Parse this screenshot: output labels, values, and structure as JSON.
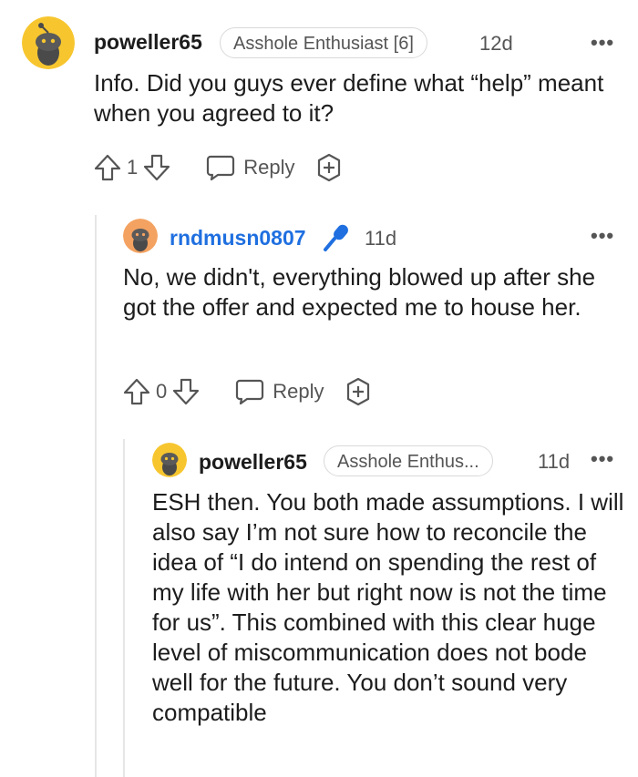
{
  "comments": [
    {
      "username": "poweller65",
      "flair": "Asshole Enthusiast [6]",
      "time": "12d",
      "body": "Info. Did you guys ever define what “help” meant when you agreed to it?",
      "vote_count": "1",
      "reply_label": "Reply",
      "avatar_color": "#f7c62f"
    },
    {
      "username": "rndmusn0807",
      "time": "11d",
      "body": "No, we didn't, everything blowed up after she got the offer and expected me to house her.",
      "vote_count": "0",
      "reply_label": "Reply",
      "avatar_color": "#f4a261",
      "username_color": "#1f6fe0"
    },
    {
      "username": "poweller65",
      "flair": "Asshole Enthus...",
      "time": "11d",
      "body": "ESH then. You both made assumptions. I will also say I’m not sure how to reconcile the idea of “I do intend on spending the rest of my life with her but right now is not the time for us”. This combined with this clear huge level of miscommunication does not bode well for the future. You don’t sound very compatible",
      "avatar_color": "#f7c62f"
    }
  ],
  "more_options": "•••"
}
